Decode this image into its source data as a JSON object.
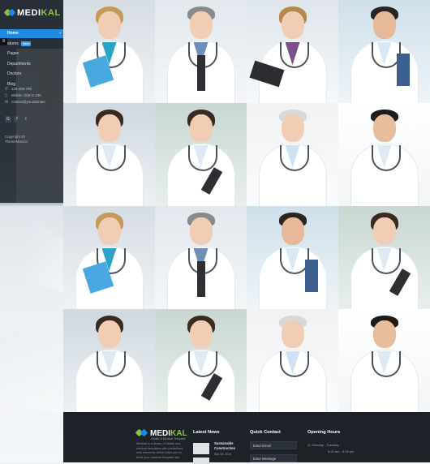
{
  "brand": {
    "name_a": "MEDI",
    "name_b": "KAL",
    "tagline": "Health & Medical Template"
  },
  "colors": {
    "accent": "#1f8ae0",
    "brand_green": "#8bc34a",
    "sidebar_bg": "#1e242c",
    "footer_bg": "#1d2228"
  },
  "sidebar": {
    "toggle_icon": "hamburger-icon",
    "menu": [
      {
        "label": "Home",
        "active": true,
        "chevron": "›"
      },
      {
        "label": "atures",
        "badge": "New"
      },
      {
        "label": "Pages"
      },
      {
        "label": "Departments"
      },
      {
        "label": "Doctors"
      },
      {
        "label": "Blog"
      }
    ],
    "contact": [
      {
        "icon": "phone-icon",
        "text": "123-456-789"
      },
      {
        "icon": "mobile-icon",
        "text": "Mobile: (0)6 to 230"
      },
      {
        "icon": "mail-icon",
        "text": "contact@yourdomain"
      }
    ],
    "social": [
      {
        "icon": "googleplus-icon",
        "glyph": "G"
      },
      {
        "icon": "facebook-icon",
        "glyph": "f"
      },
      {
        "icon": "twitter-icon",
        "glyph": "t"
      }
    ],
    "copyright_1": "Copyright 20",
    "copyright_2": "ThemeMascot"
  },
  "footer": {
    "about": "Medikal is a library of health and medical templates with predefined web elements which helps you to build your medical template site",
    "latest_news": {
      "heading": "Latest News",
      "items": [
        {
          "title_1": "Sustainable",
          "title_2": "Construction",
          "date": "Mar 08, 2015"
        }
      ]
    },
    "quick_contact": {
      "heading": "Quick Contact",
      "email_placeholder": "Enter Email",
      "message_placeholder": "Enter Message"
    },
    "opening_hours": {
      "heading": "Opening Hours",
      "rows": [
        {
          "day": "Monday - Tuesday :",
          "time": "8.00 am - 9.00 pm"
        }
      ]
    }
  }
}
